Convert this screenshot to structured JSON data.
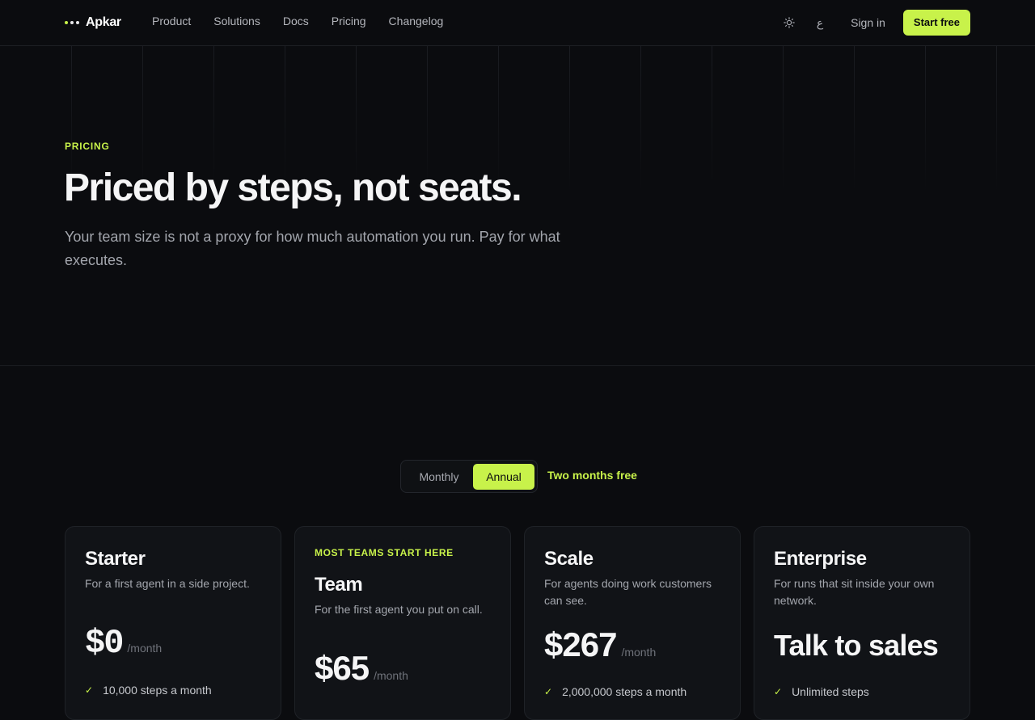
{
  "brand": {
    "name": "Apkar"
  },
  "nav": {
    "links": [
      "Product",
      "Solutions",
      "Docs",
      "Pricing",
      "Changelog"
    ],
    "theme_icon": "sun-icon",
    "lang_icon": "language-glyph-icon",
    "lang_glyph": "ع",
    "signin": "Sign in",
    "cta": "Start free"
  },
  "hero": {
    "eyebrow": "PRICING",
    "title": "Priced by steps, not seats.",
    "subtitle": "Your team size is not a proxy for how much automation you run. Pay for what executes."
  },
  "billing": {
    "options": [
      "Monthly",
      "Annual"
    ],
    "selected": "Annual",
    "note": "Two months free"
  },
  "plans": [
    {
      "name": "Starter",
      "description": "For a first agent in a side project.",
      "price": "$0",
      "period": "/month",
      "feature": "10,000 steps a month"
    },
    {
      "tag": "MOST TEAMS START HERE",
      "name": "Team",
      "description": "For the first agent you put on call.",
      "price": "$65",
      "period": "/month"
    },
    {
      "name": "Scale",
      "description": "For agents doing work customers can see.",
      "price": "$267",
      "period": "/month",
      "feature": "2,000,000 steps a month"
    },
    {
      "name": "Enterprise",
      "description": "For runs that sit inside your own network.",
      "price": "Talk to sales",
      "feature": "Unlimited steps"
    }
  ],
  "colors": {
    "accent": "#c8f24a",
    "background": "#0b0c0f",
    "card": "#111317"
  }
}
